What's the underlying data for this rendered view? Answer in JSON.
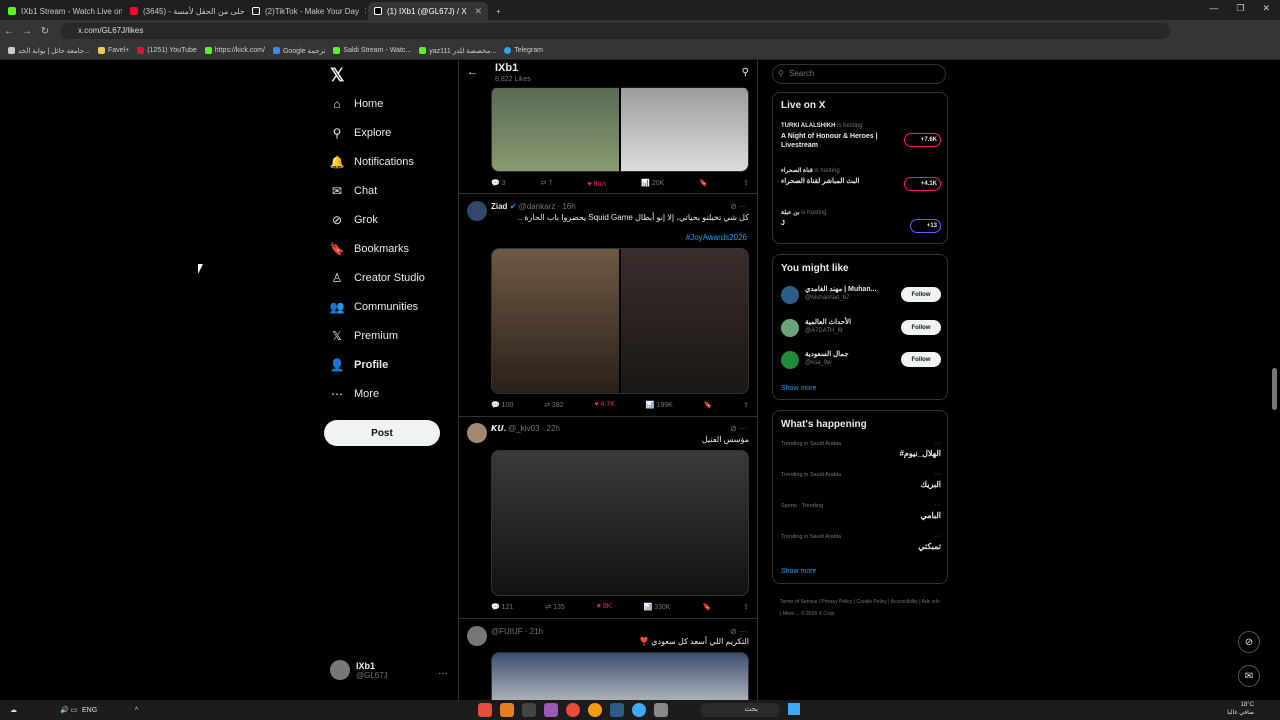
{
  "browser": {
    "tabs": [
      {
        "title": "IXb1 Stream - Watch Live on Ki",
        "color": "#53fc18"
      },
      {
        "title": "أحلى من الحقل لأمسة - (3645)",
        "color": "#ff0033"
      },
      {
        "title": "(2)TikTok - Make Your Day",
        "color": "#ffffff"
      },
      {
        "title": "(1) IXb1 (@GL67J) / X",
        "color": "#ffffff"
      }
    ],
    "url": "x.com/GL67J/likes",
    "bookmarks": [
      {
        "label": "جامعة حائل | بوابة الخد...",
        "color": "#ccc"
      },
      {
        "label": "Favel+",
        "color": "#f2c94c"
      },
      {
        "label": "(1251) YouTube",
        "color": "#ff0033"
      },
      {
        "label": "https://kick.com/",
        "color": "#53fc18"
      },
      {
        "label": "Google ترجمة",
        "color": "#4285f4"
      },
      {
        "label": "Saldi Stream - Watc...",
        "color": "#53fc18"
      },
      {
        "label": "yaz111 مخصصة للدر...",
        "color": "#53fc18"
      },
      {
        "label": "Telegram",
        "color": "#29a9eb"
      }
    ]
  },
  "nav": {
    "items": [
      {
        "label": "Home",
        "icon": "⌂"
      },
      {
        "label": "Explore",
        "icon": "⚲"
      },
      {
        "label": "Notifications",
        "icon": "🔔"
      },
      {
        "label": "Chat",
        "icon": "✉"
      },
      {
        "label": "Grok",
        "icon": "⊘"
      },
      {
        "label": "Bookmarks",
        "icon": "🔖"
      },
      {
        "label": "Creator Studio",
        "icon": "♙"
      },
      {
        "label": "Communities",
        "icon": "👥"
      },
      {
        "label": "Premium",
        "icon": "𝕏"
      },
      {
        "label": "Profile",
        "icon": "👤"
      },
      {
        "label": "More",
        "icon": "⋯"
      }
    ],
    "post": "Post",
    "account": {
      "name": "IXb1",
      "handle": "@GL67J"
    }
  },
  "header": {
    "title": "IXb1",
    "subtitle": "8,822 Likes"
  },
  "tweets": [
    {
      "actions": {
        "replies": "3",
        "reposts": "7",
        "likes": "8แก",
        "views": "20K"
      }
    },
    {
      "name": "Ziad",
      "handle": "@dankarz · 16h",
      "text": "كل شي تخيلتو بحياتي، إلا إنو أبطال Squid Game يحضروا باب الحارة ..",
      "hashtag": "#JoyAwards2026",
      "actions": {
        "replies": "100",
        "reposts": "282",
        "likes": "4.7K",
        "views": "199K"
      }
    },
    {
      "name": "𝙆𝙐.",
      "handle": "@_kiv03 · 22h",
      "text": "مؤسس الفتيل",
      "actions": {
        "replies": "121",
        "reposts": "135",
        "likes": "9K",
        "views": "330K"
      }
    },
    {
      "name": "",
      "handle": "@FUIUF · 21h",
      "text": "التكريم اللي أسعد كل سعودي ❣️"
    }
  ],
  "right": {
    "search_placeholder": "Search",
    "live_title": "Live on X",
    "live": [
      {
        "host": "TURKI ALALSHIKH",
        "status": "is hosting",
        "title": "A Night of Honour & Heroes | Livestream",
        "count": "+7.6K"
      },
      {
        "host": "قناة الصحراء",
        "status": "is hosting",
        "title": "البث المباشر لقناة الصحراء",
        "count": "+4.1K"
      },
      {
        "host": "بن عبلة",
        "status": "is hosting",
        "title": "J",
        "count": "+13"
      }
    ],
    "suggest_title": "You might like",
    "suggestions": [
      {
        "name": "مهند الغامدي | Muhan...",
        "handle": "@Muhannad_b7",
        "follow": "Follow",
        "color": "#2b5f8a"
      },
      {
        "name": "الأحداث العالمية",
        "handle": "@A7DATH_M",
        "follow": "Follow",
        "color": "#6aa57a"
      },
      {
        "name": "جمال السعودية",
        "handle": "@ksa_9w",
        "follow": "Follow",
        "color": "#1f8a3b"
      }
    ],
    "show_more": "Show more",
    "happening_title": "What's happening",
    "trends": [
      {
        "category": "Trending in Saudi Arabia",
        "name": "#الهلال_نيوم"
      },
      {
        "category": "Trending in Saudi Arabia",
        "name": "البريك"
      },
      {
        "category": "Sports · Trending",
        "name": "البامي"
      },
      {
        "category": "Trending in Saudi Arabia",
        "name": "تمبكتي"
      }
    ],
    "footer": [
      "Terms of Service",
      "Privacy Policy",
      "Cookie Policy",
      "Accessibility",
      "Ads info",
      "More ...",
      "© 2026 X Corp."
    ]
  },
  "taskbar": {
    "lang": "ENG",
    "search": "بحث",
    "weather": "18°C",
    "weather_desc": "صافي غالبا"
  }
}
